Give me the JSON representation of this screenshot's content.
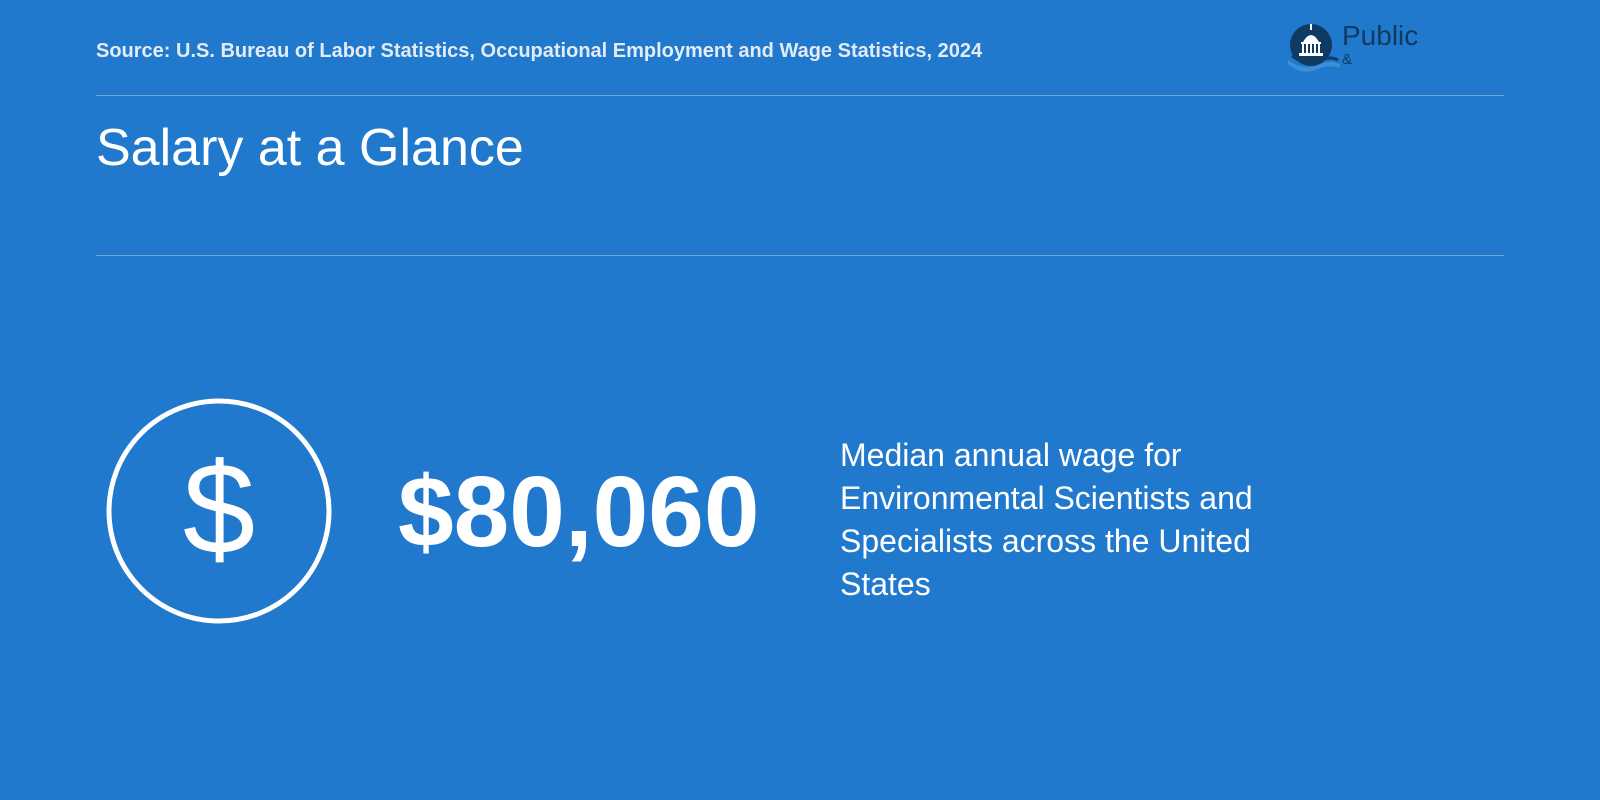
{
  "header": {
    "source": "Source: U.S. Bureau of Labor Statistics, Occupational Employment and Wage Statistics, 2024",
    "logo": {
      "icon": "capitol-dome-icon",
      "word": "Public",
      "sub_before": "",
      "sub_amp": "&",
      "sub_after": ""
    }
  },
  "title": "Salary at a Glance",
  "stat": {
    "icon": "dollar-circle-icon",
    "symbol": "$",
    "value": "$80,060",
    "description": "Median annual wage for Environmental Scientists and Specialists across the United States"
  },
  "colors": {
    "background": "#2079cd",
    "text": "#ffffff",
    "logo_dark": "#0f3a63"
  }
}
